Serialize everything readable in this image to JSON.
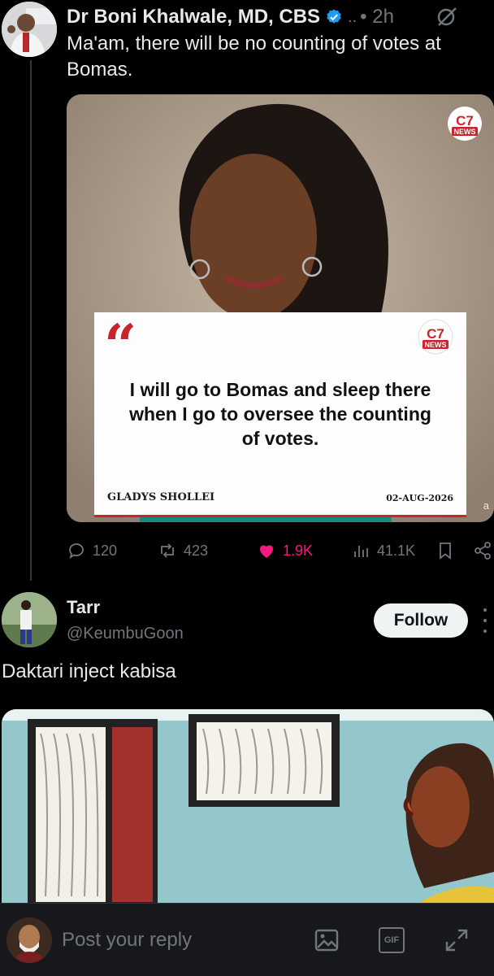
{
  "post": {
    "author": "Dr Boni Khalwale, MD, CBS",
    "dots": "..",
    "time": "• 2h",
    "text": "Ma'am, there will be no counting of votes at Bomas.",
    "media": {
      "logo_text": "NEWS",
      "logo_mark": "C7",
      "quote": "I will go to Bomas and sleep there when I go to oversee the counting of votes.",
      "quote_author": "GLADYS SHOLLEI",
      "quote_date": "02-AUG-2026",
      "watermark": "a"
    },
    "stats": {
      "replies": "120",
      "reposts": "423",
      "likes": "1.9K",
      "views": "41.1K"
    }
  },
  "reply": {
    "name": "Tarr",
    "handle": "@KeumbuGoon",
    "follow_label": "Follow",
    "text": "Daktari inject kabisa"
  },
  "composer": {
    "placeholder": "Post your reply",
    "gif_label": "GIF"
  },
  "colors": {
    "background": "#000000",
    "like": "#f91880",
    "verified": "#1d9bf0",
    "brand_red": "#c8242a"
  }
}
